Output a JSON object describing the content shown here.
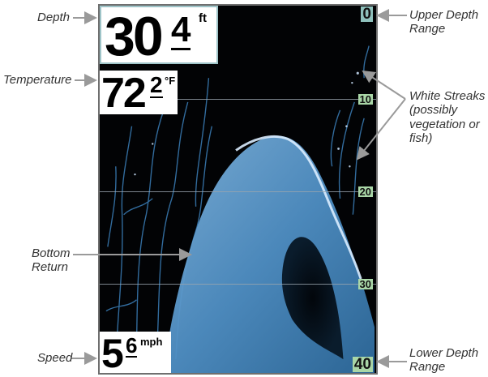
{
  "readouts": {
    "depth": {
      "value": "30",
      "tenths": "4",
      "unit": "ft"
    },
    "temperature": {
      "value": "72",
      "tenths": "2",
      "unit": "°F"
    },
    "speed": {
      "value": "5",
      "tenths": "6",
      "unit": "mph"
    }
  },
  "depth_scale": [
    "0",
    "10",
    "20",
    "30",
    "40"
  ],
  "callouts": {
    "depth": "Depth",
    "temperature": "Temperature",
    "bottom_return_line1": "Bottom",
    "bottom_return_line2": "Return",
    "speed": "Speed",
    "upper_range_line1": "Upper Depth",
    "upper_range_line2": "Range",
    "streaks_line1": "White Streaks",
    "streaks_line2": "(possibly",
    "streaks_line3": "vegetation or",
    "streaks_line4": "fish)",
    "lower_range_line1": "Lower Depth",
    "lower_range_line2": "Range"
  },
  "colors": {
    "sonar_background": "#020305",
    "sonar_return": "#4f8fc4",
    "sonar_highlight": "#d9ecff",
    "scale_label_bg": "#a9d6a7",
    "leader_arrow": "#9a9a9a"
  }
}
